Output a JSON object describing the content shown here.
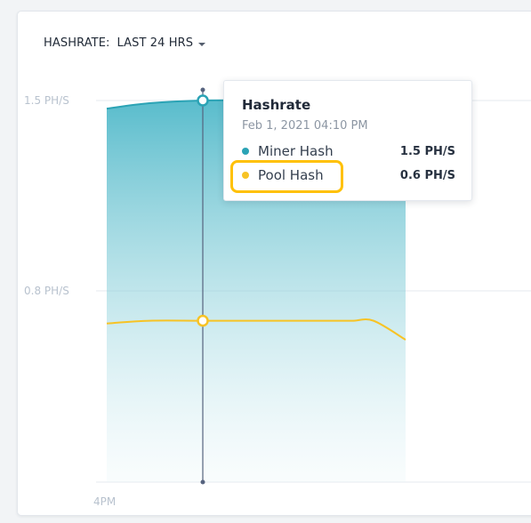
{
  "header": {
    "label": "HASHRATE:",
    "range": "LAST 24 HRS"
  },
  "colors": {
    "miner": "#2ba3b5",
    "pool": "#f7c325",
    "crosshair": "#56637e",
    "grid": "#e6eaef",
    "highlight": "#ffc107"
  },
  "chart_data": {
    "type": "area",
    "title": "Hashrate",
    "ylabel": "",
    "xlabel": "",
    "y_ticks": [
      "1.5 PH/S",
      "0.8 PH/S"
    ],
    "y_tick_values": [
      1.5,
      0.8
    ],
    "x_ticks": [
      "4PM"
    ],
    "ylim": [
      0,
      1.5
    ],
    "grid": true,
    "series": [
      {
        "name": "Miner Hash",
        "color": "#2ba3b5",
        "x": [
          0,
          0.2,
          0.45,
          0.75,
          0.95,
          1.05,
          1.15,
          1.25,
          1.4
        ],
        "values": [
          1.47,
          1.49,
          1.5,
          1.5,
          1.5,
          1.5,
          1.5,
          1.5,
          1.45
        ]
      },
      {
        "name": "Pool Hash",
        "color": "#f7c325",
        "x": [
          0,
          0.2,
          0.45,
          0.75,
          0.95,
          1.05,
          1.15,
          1.25,
          1.4
        ],
        "values": [
          0.68,
          0.69,
          0.69,
          0.69,
          0.69,
          0.69,
          0.69,
          0.69,
          0.62
        ]
      }
    ],
    "crosshair_x": 0.45
  },
  "tooltip": {
    "title": "Hashrate",
    "date": "Feb 1, 2021 04:10 PM",
    "rows": [
      {
        "name": "Miner Hash",
        "value": "1.5 PH/S",
        "color": "#2ba3b5"
      },
      {
        "name": "Pool Hash",
        "value": "0.6 PH/S",
        "color": "#f7c325"
      }
    ]
  }
}
